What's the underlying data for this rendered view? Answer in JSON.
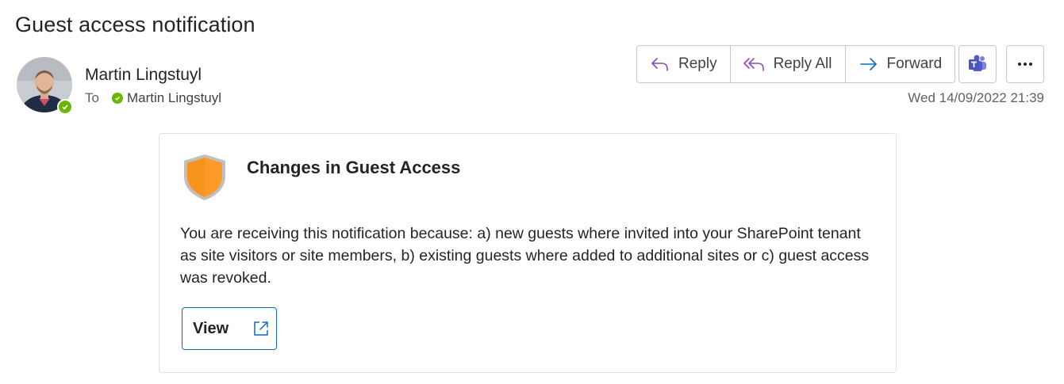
{
  "email": {
    "subject": "Guest access notification",
    "sender": "Martin Lingstuyl",
    "to_label": "To",
    "recipient": "Martin Lingstuyl",
    "date": "Wed 14/09/2022 21:39"
  },
  "toolbar": {
    "reply_label": "Reply",
    "reply_all_label": "Reply All",
    "forward_label": "Forward",
    "teams_icon": "teams-icon",
    "more_icon": "more-icon"
  },
  "card": {
    "title": "Changes in Guest Access",
    "body": "You are receiving this notification because: a) new guests where invited into your SharePoint tenant as site visitors or site members, b) existing guests where added to additional sites or c) guest access was revoked.",
    "view_label": "View",
    "icon": "shield-icon"
  },
  "colors": {
    "presence": "#6bb700",
    "accent": "#0f6cbd",
    "reply_icon": "#8a4cb4",
    "forward_icon": "#0f6cbd",
    "shield": "#f7941d"
  }
}
